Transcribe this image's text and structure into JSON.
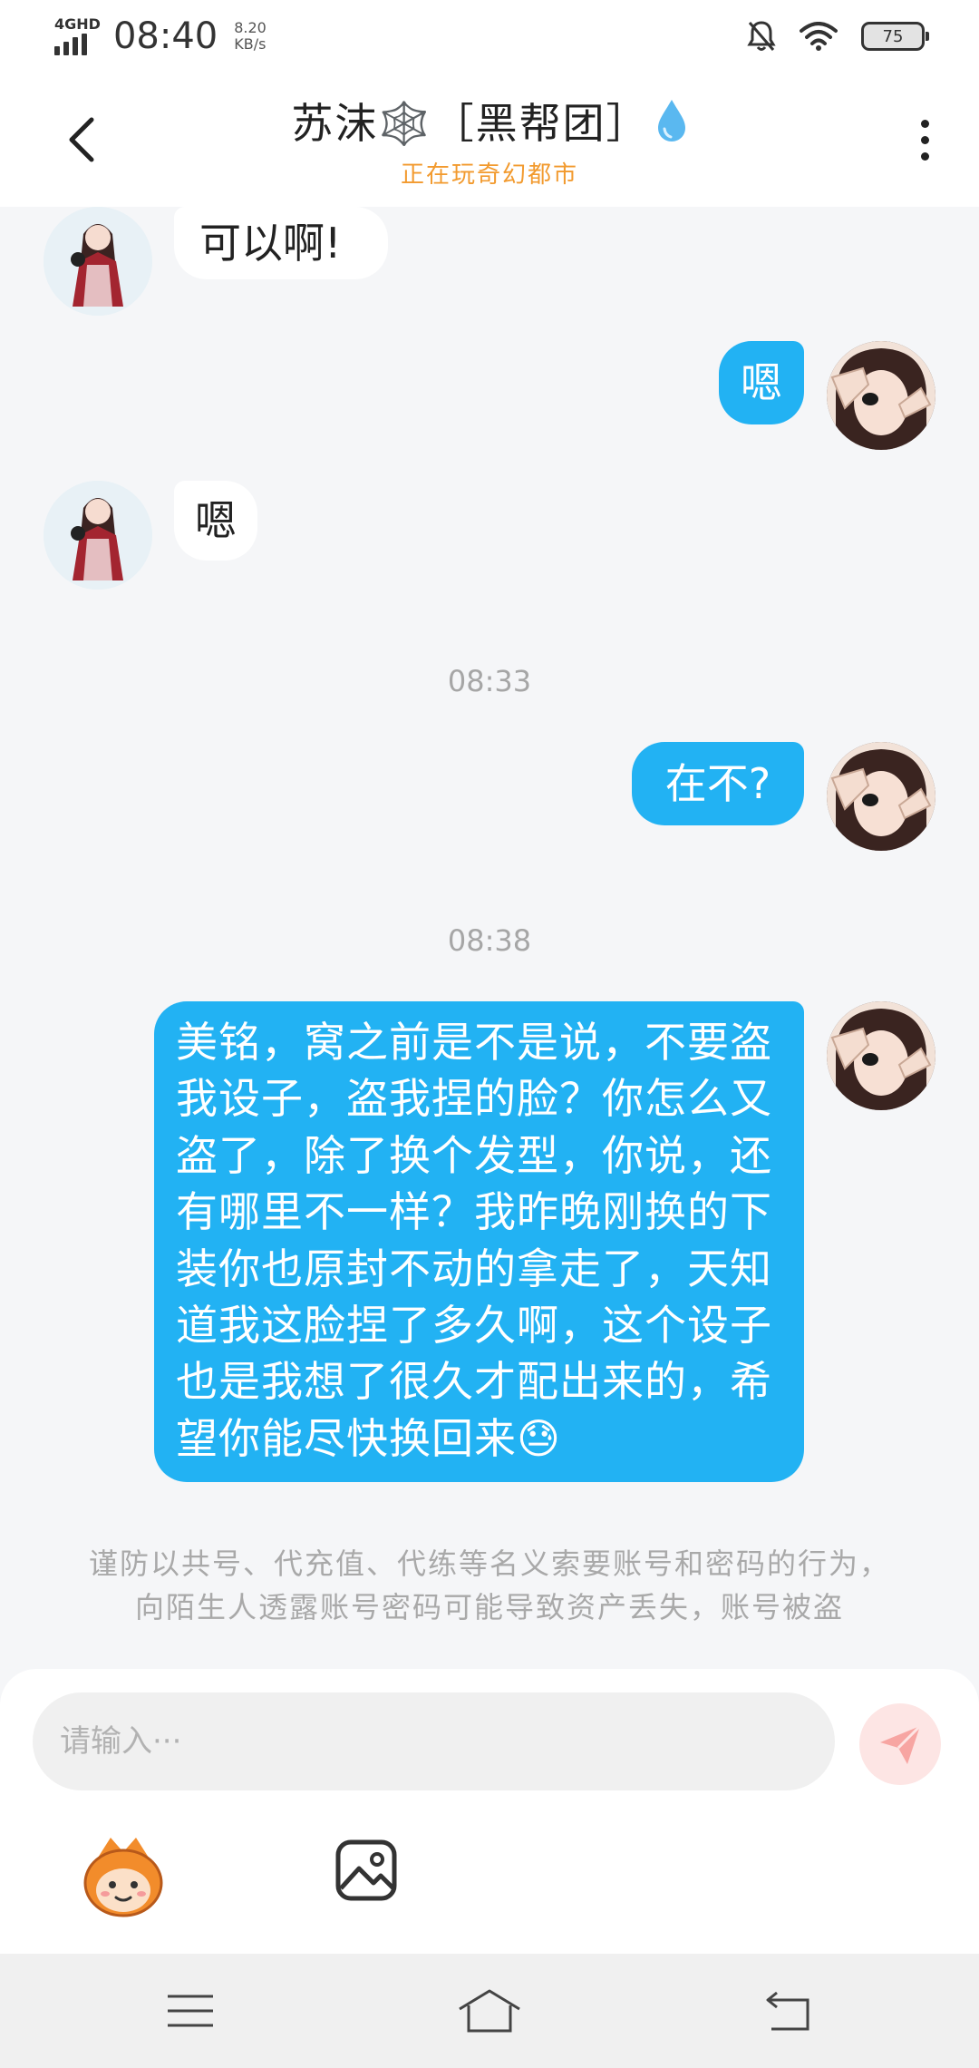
{
  "status_bar": {
    "network_type": "4GHD",
    "time": "08:40",
    "speed_value": "8.20",
    "speed_unit": "KB/s",
    "battery": "75"
  },
  "header": {
    "contact_name": "苏沫🕸️［黑帮团］",
    "status_text": "正在玩奇幻都市"
  },
  "messages": [
    {
      "sender": "other",
      "text": "可以啊!"
    },
    {
      "sender": "self",
      "text": "嗯"
    },
    {
      "sender": "other",
      "text": "嗯"
    },
    {
      "type": "timestamp",
      "text": "08:33"
    },
    {
      "sender": "self",
      "text": "在不?"
    },
    {
      "type": "timestamp",
      "text": "08:38"
    },
    {
      "sender": "self",
      "text": "美铭，窝之前是不是说，不要盗我设子，盗我捏的脸？你怎么又盗了，除了换个发型，你说，还有哪里不一样？我昨晚刚换的下装你也原封不动的拿走了，天知道我这脸捏了多久啊，这个设子也是我想了很久才配出来的，希望你能尽快换回来😓"
    }
  ],
  "warning": "谨防以共号、代充值、代练等名义索要账号和密码的行为，向陌生人透露账号密码可能导致资产丢失，账号被盗",
  "input": {
    "placeholder": "请输入···",
    "value": ""
  },
  "colors": {
    "outgoing_bubble": "#22b2f3",
    "incoming_bubble": "#ffffff",
    "status_text": "#f29a2e",
    "send_button_bg": "#fde5e4",
    "send_icon": "#f7a5a2"
  },
  "icons": {
    "back": "chevron-left-icon",
    "more": "more-vertical-icon",
    "send": "paper-plane-icon",
    "emoji": "emoji-mascot-icon",
    "image": "image-icon",
    "nav_menu": "menu-icon",
    "nav_home": "home-icon",
    "nav_back": "back-icon"
  }
}
